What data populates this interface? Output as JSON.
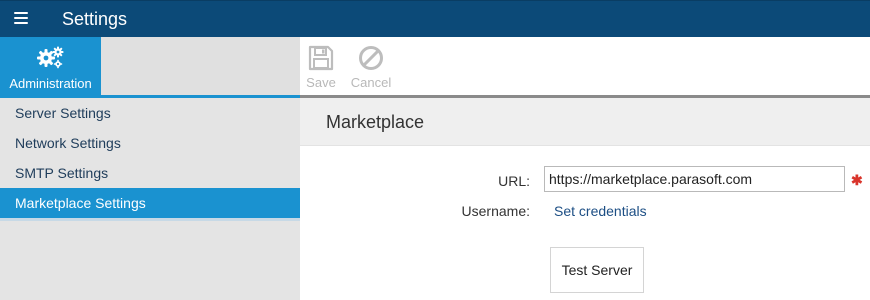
{
  "header": {
    "menu_icon": "hamburger-icon",
    "title": "Settings",
    "bg_color": "#0c4a78"
  },
  "sidebar": {
    "admin_tab": {
      "label": "Administration",
      "icon": "gears-icon"
    },
    "items": [
      {
        "label": "Server Settings",
        "active": false
      },
      {
        "label": "Network Settings",
        "active": false
      },
      {
        "label": "SMTP Settings",
        "active": false
      },
      {
        "label": "Marketplace Settings",
        "active": true
      }
    ],
    "accent_color": "#1a92d0"
  },
  "toolbar": {
    "save_label": "Save",
    "save_icon": "save-disk-icon",
    "cancel_label": "Cancel",
    "cancel_icon": "cancel-circle-icon",
    "disabled": true
  },
  "main": {
    "section_title": "Marketplace",
    "url_label": "URL:",
    "url_value": "https://marketplace.parasoft.com",
    "url_required": true,
    "required_marker": "✱",
    "username_label": "Username:",
    "credentials_link": "Set credentials",
    "test_button": "Test Server"
  }
}
